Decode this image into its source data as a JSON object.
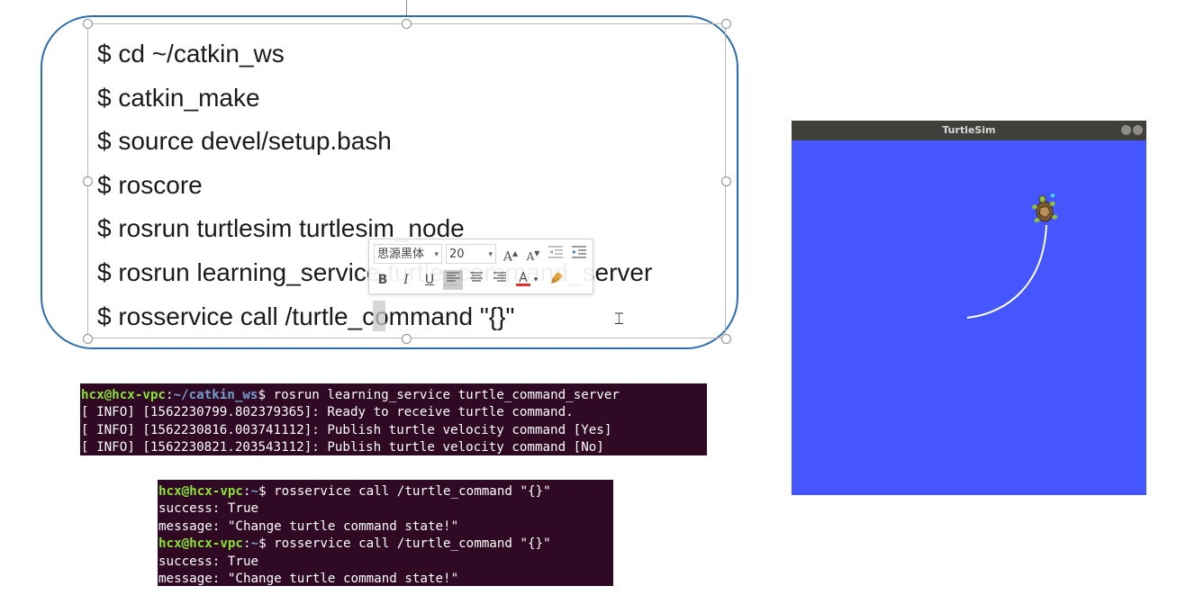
{
  "slide": {
    "commands": [
      "$ cd ~/catkin_ws",
      "$ catkin_make",
      "$ source devel/setup.bash",
      "$ roscore",
      "$ rosrun turtlesim turtlesim_node",
      "$ rosrun learning_service turtle_command_server",
      "$ rosservice call /turtle_command \"{}\""
    ]
  },
  "mini_toolbar": {
    "font_name": "思源黑体",
    "font_size": "20",
    "grow_font": "A",
    "shrink_font": "A",
    "bold": "B",
    "italic": "I",
    "underline": "U",
    "font_color": "A"
  },
  "terminal1": {
    "prompt_user": "hcx@hcx-vpc",
    "prompt_path": "~/catkin_ws",
    "command": "$ rosrun learning_service turtle_command_server",
    "output": [
      "[ INFO] [1562230799.802379365]: Ready to receive turtle command.",
      "[ INFO] [1562230816.003741112]: Publish turtle velocity command [Yes]",
      "[ INFO] [1562230821.203543112]: Publish turtle velocity command [No]"
    ]
  },
  "terminal2": {
    "prompt_user": "hcx@hcx-vpc",
    "prompt_path": "~",
    "command": "$ rosservice call /turtle_command \"{}\"",
    "success_line": "success: True",
    "message_line": "message: \"Change turtle command state!\""
  },
  "turtlesim": {
    "title": "TurtleSim",
    "background_color": "#4556ff",
    "trail_color": "#ffffff"
  },
  "colors": {
    "textbox_border": "#2a6cb0",
    "terminal_bg": "#300a24",
    "prompt_user": "#8ae234",
    "prompt_path": "#729fcf"
  }
}
